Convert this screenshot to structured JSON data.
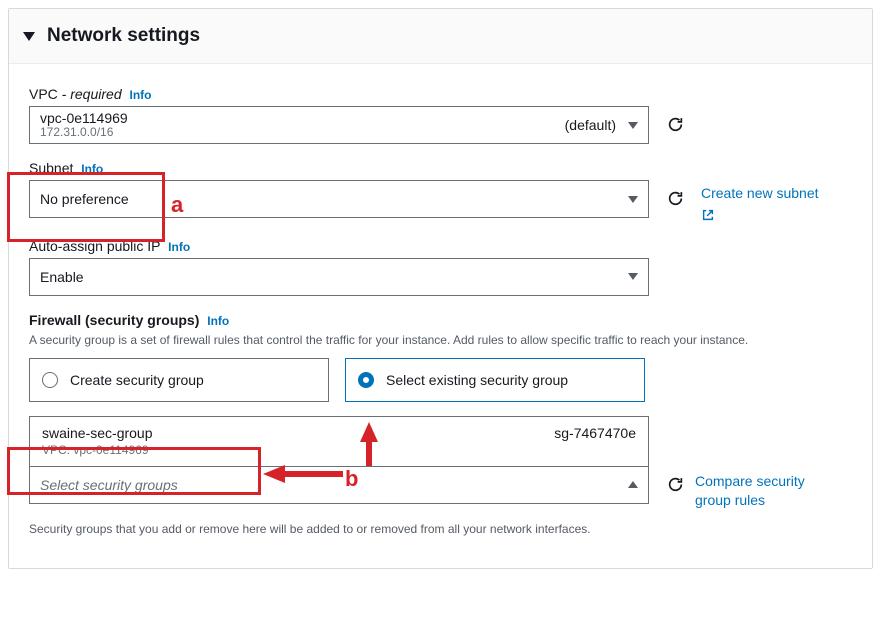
{
  "panel": {
    "title": "Network settings"
  },
  "vpc": {
    "label": "VPC",
    "required": " - required",
    "info": "Info",
    "value": "vpc-0e114969",
    "default_tag": "(default)",
    "cidr": "172.31.0.0/16"
  },
  "subnet": {
    "label": "Subnet",
    "info": "Info",
    "value": "No preference",
    "create_link": "Create new subnet"
  },
  "public_ip": {
    "label": "Auto-assign public IP",
    "info": "Info",
    "value": "Enable"
  },
  "firewall": {
    "label": "Firewall (security groups)",
    "info": "Info",
    "helper": "A security group is a set of firewall rules that control the traffic for your instance. Add rules to allow specific traffic to reach your instance.",
    "radio_create": "Create security group",
    "radio_existing": "Select existing security group",
    "selected_sg_name": "swaine-sec-group",
    "selected_sg_vpc": "VPC: vpc-0e114969",
    "selected_sg_id": "sg-7467470e",
    "search_placeholder": "Select security groups",
    "compare_link": "Compare security group rules",
    "footer_note": "Security groups that you add or remove here will be added to or removed from all your network interfaces."
  },
  "annotations": {
    "a": "a",
    "b": "b"
  }
}
